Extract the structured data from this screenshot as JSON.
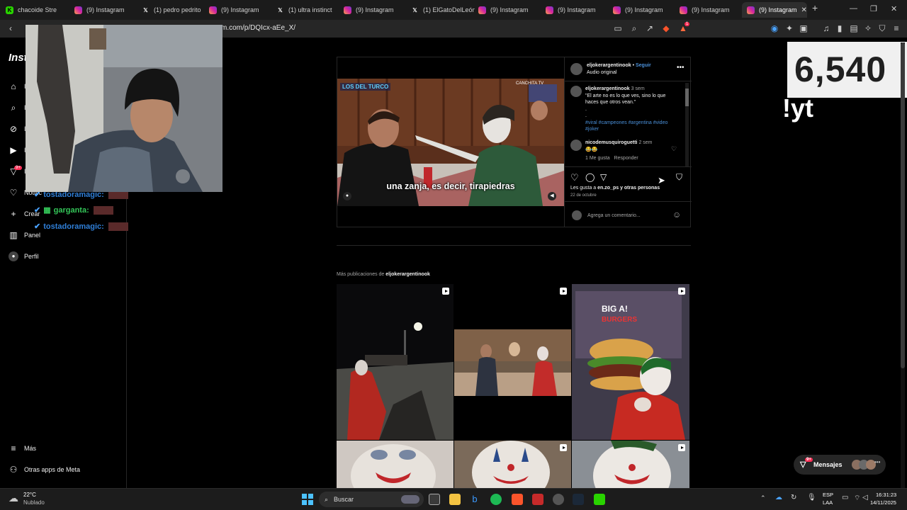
{
  "tabs": [
    {
      "label": "chacoide Stre",
      "icon": "kick-icon",
      "active": false
    },
    {
      "label": "(9) Instagram",
      "icon": "instagram-icon",
      "active": false
    },
    {
      "label": "(1) pedro pedrito",
      "icon": "x-icon",
      "active": false
    },
    {
      "label": "(9) Instagram",
      "icon": "instagram-icon",
      "active": false
    },
    {
      "label": "(1) ultra instinct",
      "icon": "x-icon",
      "active": false
    },
    {
      "label": "(9) Instagram",
      "icon": "instagram-icon",
      "active": false
    },
    {
      "label": "(1) ElGatoDelLeón",
      "icon": "x-icon",
      "active": false
    },
    {
      "label": "(9) Instagram",
      "icon": "instagram-icon",
      "active": false
    },
    {
      "label": "(9) Instagram",
      "icon": "instagram-icon",
      "active": false
    },
    {
      "label": "(9) Instagram",
      "icon": "instagram-icon",
      "active": false
    },
    {
      "label": "(9) Instagram",
      "icon": "instagram-icon",
      "active": false
    },
    {
      "label": "(9) Instagram",
      "icon": "instagram-icon",
      "active": true
    }
  ],
  "address": {
    "url": "m.com/p/DQIcx-aEe_X/"
  },
  "brave_badge": "1",
  "sidebar": {
    "logo": "Insta",
    "items": [
      {
        "label": "I",
        "icon": "home-icon"
      },
      {
        "label": "I",
        "icon": "search-icon"
      },
      {
        "label": "I",
        "icon": "explore-icon"
      },
      {
        "label": "I",
        "icon": "reels-icon"
      },
      {
        "label": "I",
        "icon": "messages-icon",
        "badge": "9+"
      },
      {
        "label": "Notific",
        "icon": "heart-icon"
      },
      {
        "label": "Crear",
        "icon": "plus-icon"
      },
      {
        "label": "Panel",
        "icon": "dashboard-icon"
      },
      {
        "label": "Perfil",
        "icon": "profile-icon"
      }
    ],
    "more": {
      "label": "Más",
      "icon": "menu-icon"
    },
    "meta": {
      "label": "Otras apps de Meta",
      "icon": "meta-apps-icon"
    }
  },
  "chat": [
    {
      "user": "tostadoramagic:"
    },
    {
      "user": "garganta:"
    },
    {
      "user": "tostadoramagic:"
    }
  ],
  "post": {
    "username": "eljokerargentinook",
    "follow": "Seguir",
    "audio": "Audio original",
    "subtitle": "una zanja, es decir, tirapiedras",
    "video_overlay_left": "LOS DEL TURCO",
    "video_overlay_right": "CANCHITA TV",
    "caption": {
      "username": "eljokerargentinook",
      "time": "3 sem",
      "text": "\"El arte no es lo que ves, sino lo que haces que otros vean.\"",
      "dots": ".",
      "hashtags": "#viral #campeones #argentina #video #joker"
    },
    "comment": {
      "username": "nicodemusquiroguetti",
      "time": "2 sem",
      "text": "😂😂",
      "likes": "1 Me gusta",
      "reply": "Responder"
    },
    "likes_text_prefix": "Les gusta a",
    "likes_user": "en.zo_ps",
    "likes_text_suffix": "y otras personas",
    "date": "22 de octubre",
    "comment_placeholder": "Agrega un comentario..."
  },
  "more_posts": {
    "prefix": "Más publicaciones de",
    "username": "eljokerargentinook"
  },
  "overlay": {
    "counter": "6,540",
    "command": "!yt"
  },
  "messages_pill": {
    "label": "Mensajes",
    "badge": "9+"
  },
  "taskbar": {
    "weather_temp": "22°C",
    "weather_desc": "Nublado",
    "search": "Buscar",
    "lang_top": "ESP",
    "lang_bottom": "LAA",
    "time": "16:31:23",
    "date": "14/11/2025"
  }
}
